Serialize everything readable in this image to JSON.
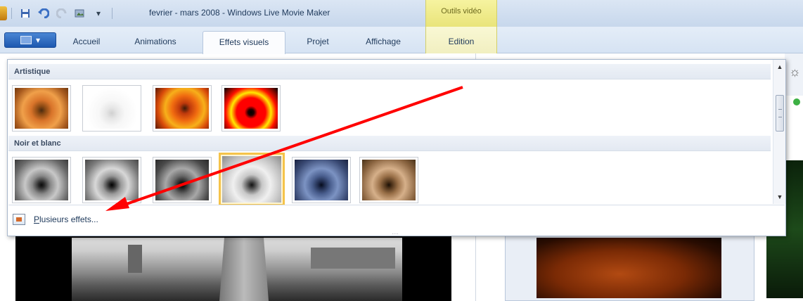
{
  "window": {
    "title": "fevrier - mars 2008 - Windows Live Movie Maker",
    "context_group": "Outils vidéo"
  },
  "ribbon": {
    "tabs": [
      {
        "label": "Accueil"
      },
      {
        "label": "Animations"
      },
      {
        "label": "Effets visuels",
        "active": true
      },
      {
        "label": "Projet"
      },
      {
        "label": "Affichage"
      },
      {
        "label": "Edition",
        "context": true
      }
    ]
  },
  "gallery": {
    "sections": [
      {
        "header": "Artistique",
        "thumbnails": [
          "orange",
          "white",
          "fire",
          "popred"
        ]
      },
      {
        "header": "Noir et blanc",
        "thumbnails": [
          "bw",
          "bw2",
          "bw3",
          "bwlight",
          "blue",
          "sepia"
        ],
        "selected_index": 3
      }
    ],
    "more_effects_label": "Plusieurs effets...",
    "grip": "....",
    "scroll_up_glyph": "▲",
    "scroll_down_glyph": "▼"
  },
  "annotation": {
    "arrow_color": "#ff0000"
  }
}
